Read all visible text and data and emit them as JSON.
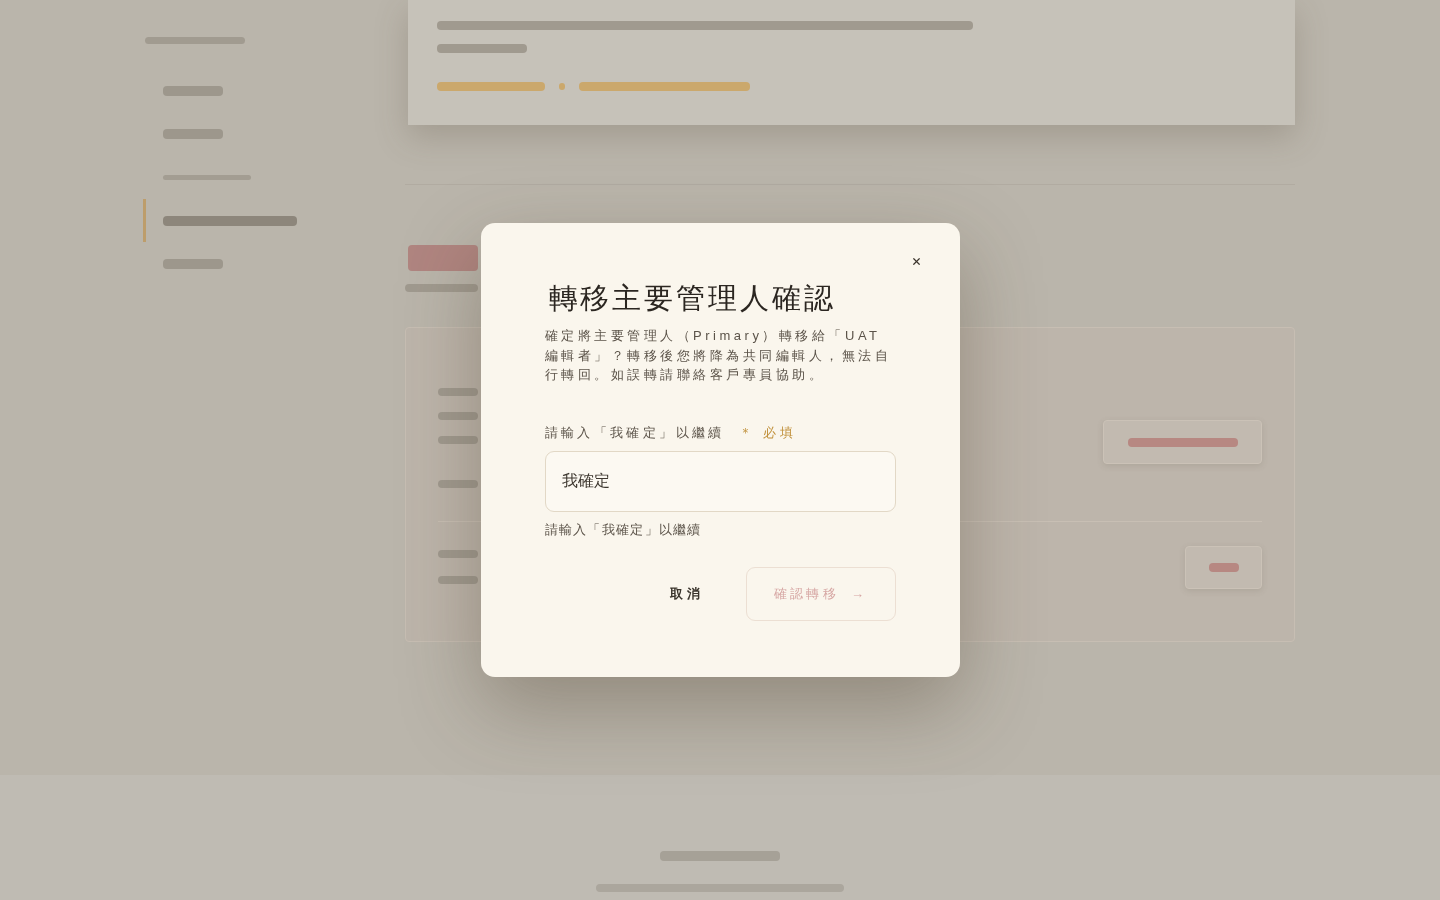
{
  "sidebar": {
    "groups": [
      {
        "items": [
          {
            "selected": false
          },
          {
            "selected": false
          }
        ]
      },
      {
        "items": [
          {
            "selected": true
          },
          {
            "selected": false
          }
        ]
      }
    ]
  },
  "dialog": {
    "title": "轉移主要管理人確認",
    "message": "確定將主要管理人（Primary）轉移給「UAT 編輯者」？轉移後您將降為共同編輯人，無法自行轉回。如誤轉請聯絡客戶專員協助。",
    "field": {
      "label": "請輸入「我確定」以繼續",
      "required": "＊ 必填",
      "value": "我確定",
      "hint": "請輸入「我確定」以繼續"
    },
    "buttons": [
      {
        "kind": "cancel",
        "label": "取消",
        "disabled": false
      },
      {
        "kind": "confirm",
        "label": "確認轉移",
        "arrow": "→",
        "disabled": true
      }
    ]
  }
}
